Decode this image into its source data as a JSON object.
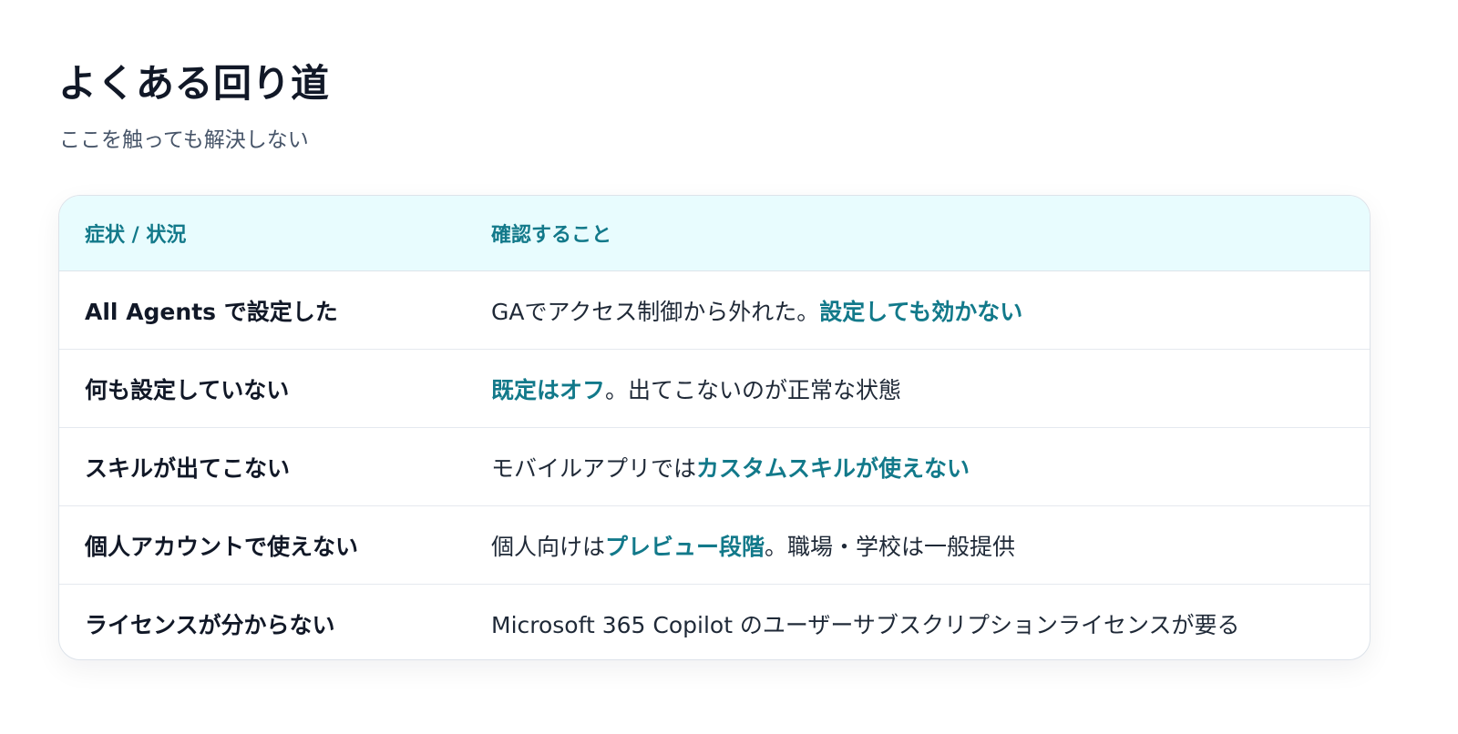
{
  "page": {
    "title": "よくある回り道",
    "subtitle": "ここを触っても解決しない"
  },
  "table": {
    "headers": {
      "symptom": "症状 / 状況",
      "check": "確認すること"
    },
    "rows": [
      {
        "symptom": "All Agents で設定した",
        "check_before": "GAでアクセス制御から外れた。",
        "check_highlight": "設定しても効かない",
        "check_after": ""
      },
      {
        "symptom": "何も設定していない",
        "check_before": "",
        "check_highlight": "既定はオフ",
        "check_after": "。出てこないのが正常な状態"
      },
      {
        "symptom": "スキルが出てこない",
        "check_before": "モバイルアプリでは",
        "check_highlight": "カスタムスキルが使えない",
        "check_after": ""
      },
      {
        "symptom": "個人アカウントで使えない",
        "check_before": "個人向けは",
        "check_highlight": "プレビュー段階",
        "check_after": "。職場・学校は一般提供"
      },
      {
        "symptom": "ライセンスが分からない",
        "check_before": "Microsoft 365 Copilot のユーザーサブスクリプションライセンスが要る",
        "check_highlight": "",
        "check_after": ""
      }
    ]
  },
  "colors": {
    "accent": "#12798a",
    "header_background": "#e8fcfe",
    "border": "#dde3ea",
    "title_text": "#111827",
    "subtitle_text": "#475569"
  }
}
